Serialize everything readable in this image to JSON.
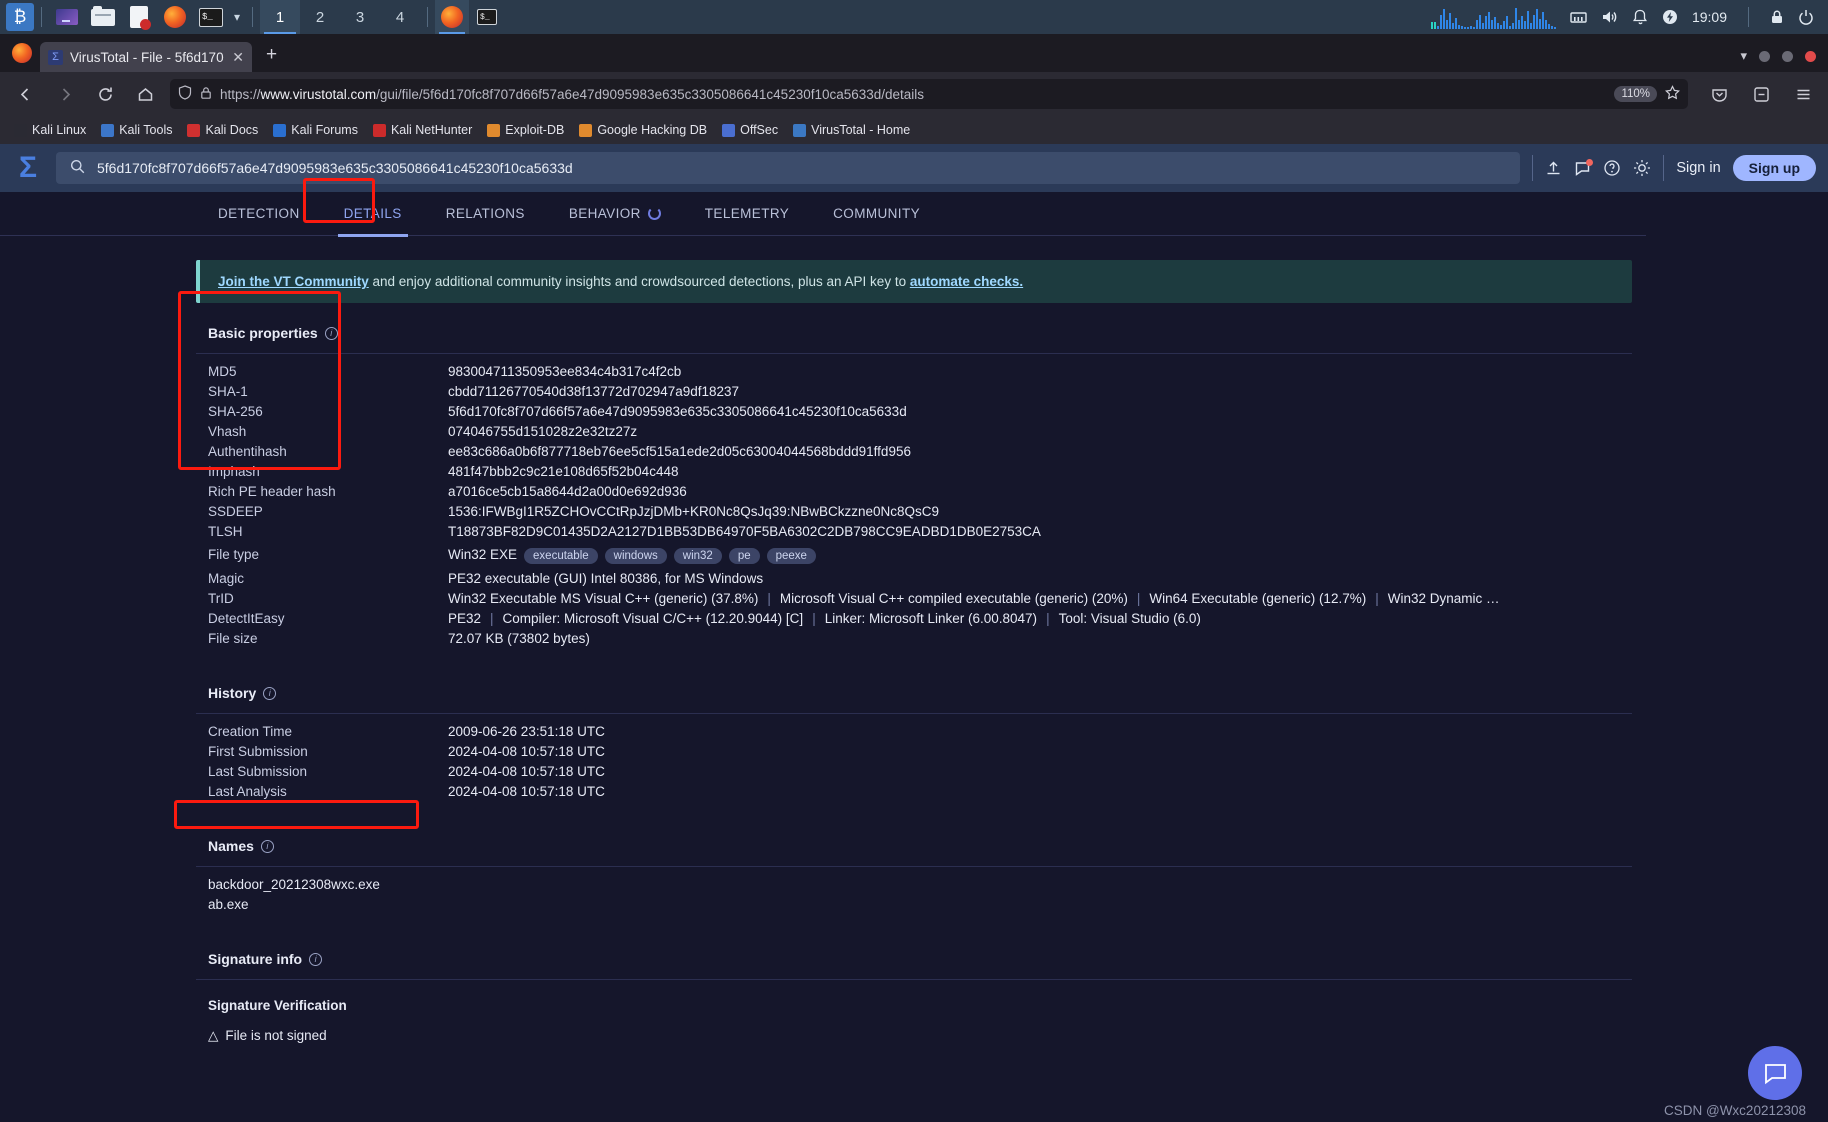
{
  "taskbar": {
    "app_icons": [
      "kali-menu",
      "terminal-purple",
      "file-manager",
      "text-editor",
      "firefox",
      "terminal"
    ],
    "workspaces": [
      "1",
      "2",
      "3",
      "4"
    ],
    "active_workspace": "1",
    "running": [
      "firefox",
      "terminal"
    ],
    "clock": "19:09",
    "tray": [
      "network-icon",
      "volume-icon",
      "bell-icon",
      "power-icon",
      "lock-icon",
      "logout-icon"
    ]
  },
  "browser": {
    "tab_title": "VirusTotal - File - 5f6d170",
    "new_tab_label": "+",
    "url_display": "https://www.virustotal.com/gui/file/5f6d170fc8f707d66f57a6e47d9095983e635c3305086641c45230f10ca5633d/details",
    "url_host": "www.virustotal.com",
    "url_path": "/gui/file/5f6d170fc8f707d66f57a6e47d9095983e635c3305086641c45230f10ca5633d/details",
    "url_scheme": "https://",
    "zoom_level": "110%",
    "bookmarks": [
      {
        "label": "Kali Linux",
        "color": "#2a2a33"
      },
      {
        "label": "Kali Tools",
        "color": "#3c76c9"
      },
      {
        "label": "Kali Docs",
        "color": "#d03030"
      },
      {
        "label": "Kali Forums",
        "color": "#2a6fd0"
      },
      {
        "label": "Kali NetHunter",
        "color": "#cc2b2b"
      },
      {
        "label": "Exploit-DB",
        "color": "#e08a2e"
      },
      {
        "label": "Google Hacking DB",
        "color": "#e08a2e"
      },
      {
        "label": "OffSec",
        "color": "#4a6ed0"
      },
      {
        "label": "VirusTotal - Home",
        "color": "#3b78c3"
      }
    ]
  },
  "vt_header": {
    "search_value": "5f6d170fc8f707d66f57a6e47d9095983e635c3305086641c45230f10ca5633d",
    "sign_in_label": "Sign in",
    "sign_up_label": "Sign up",
    "icons": [
      "upload-icon",
      "comment-icon",
      "help-icon",
      "theme-icon"
    ]
  },
  "tabs": [
    {
      "label": "DETECTION",
      "active": false
    },
    {
      "label": "DETAILS",
      "active": true
    },
    {
      "label": "RELATIONS",
      "active": false
    },
    {
      "label": "BEHAVIOR",
      "active": false,
      "spinner": true
    },
    {
      "label": "TELEMETRY",
      "active": false
    },
    {
      "label": "COMMUNITY",
      "active": false
    }
  ],
  "banner": {
    "link1": "Join the VT Community",
    "middle": " and enjoy additional community insights and crowdsourced detections, plus an API key to ",
    "link2": "automate checks."
  },
  "basic_properties": {
    "title": "Basic properties",
    "rows": [
      {
        "key": "MD5",
        "value": "983004711350953ee834c4b317c4f2cb"
      },
      {
        "key": "SHA-1",
        "value": "cbdd71126770540d38f13772d702947a9df18237"
      },
      {
        "key": "SHA-256",
        "value": "5f6d170fc8f707d66f57a6e47d9095983e635c3305086641c45230f10ca5633d"
      },
      {
        "key": "Vhash",
        "value": "074046755d151028z2e32tz27z"
      },
      {
        "key": "Authentihash",
        "value": "ee83c686a0b6f877718eb76ee5cf515a1ede2d05c63004044568bddd91ffd956"
      },
      {
        "key": "Imphash",
        "value": "481f47bbb2c9c21e108d65f52b04c448"
      },
      {
        "key": "Rich PE header hash",
        "value": "a7016ce5cb15a8644d2a00d0e692d936"
      },
      {
        "key": "SSDEEP",
        "value": "1536:IFWBgI1R5ZCHOvCCtRpJzjDMb+KR0Nc8QsJq39:NBwBCkzzne0Nc8QsC9"
      },
      {
        "key": "TLSH",
        "value": "T18873BF82D9C01435D2A2127D1BB53DB64970F5BA6302C2DB798CC9EADBD1DB0E2753CA"
      }
    ],
    "file_type": {
      "key": "File type",
      "value": "Win32 EXE",
      "tags": [
        "executable",
        "windows",
        "win32",
        "pe",
        "peexe"
      ]
    },
    "magic": {
      "key": "Magic",
      "value": "PE32 executable (GUI) Intel 80386, for MS Windows"
    },
    "trid": {
      "key": "TrID",
      "parts": [
        "Win32 Executable MS Visual C++ (generic) (37.8%)",
        "Microsoft Visual C++ compiled executable (generic) (20%)",
        "Win64 Executable (generic) (12.7%)",
        "Win32 Dynamic …"
      ]
    },
    "detectiteasy": {
      "key": "DetectItEasy",
      "parts": [
        "PE32",
        "Compiler: Microsoft Visual C/C++ (12.20.9044) [C]",
        "Linker: Microsoft Linker (6.00.8047)",
        "Tool: Visual Studio (6.0)"
      ]
    },
    "file_size": {
      "key": "File size",
      "value": "72.07 KB (73802 bytes)"
    }
  },
  "history": {
    "title": "History",
    "rows": [
      {
        "key": "Creation Time",
        "value": "2009-06-26 23:51:18 UTC"
      },
      {
        "key": "First Submission",
        "value": "2024-04-08 10:57:18 UTC"
      },
      {
        "key": "Last Submission",
        "value": "2024-04-08 10:57:18 UTC"
      },
      {
        "key": "Last Analysis",
        "value": "2024-04-08 10:57:18 UTC"
      }
    ]
  },
  "names": {
    "title": "Names",
    "rows": [
      {
        "value": "backdoor_20212308wxc.exe"
      },
      {
        "value": "ab.exe"
      }
    ]
  },
  "signature_info": {
    "title": "Signature info",
    "subtitle": "Signature Verification",
    "status": "File is not signed"
  },
  "watermark": "CSDN @Wxc20212308",
  "colors": {
    "accent": "#8fa5f0",
    "highlight_box": "#fb1a0f",
    "banner_bg": "#1d3b3f",
    "page_bg": "#15162b",
    "header_bg": "#2b3a58"
  }
}
